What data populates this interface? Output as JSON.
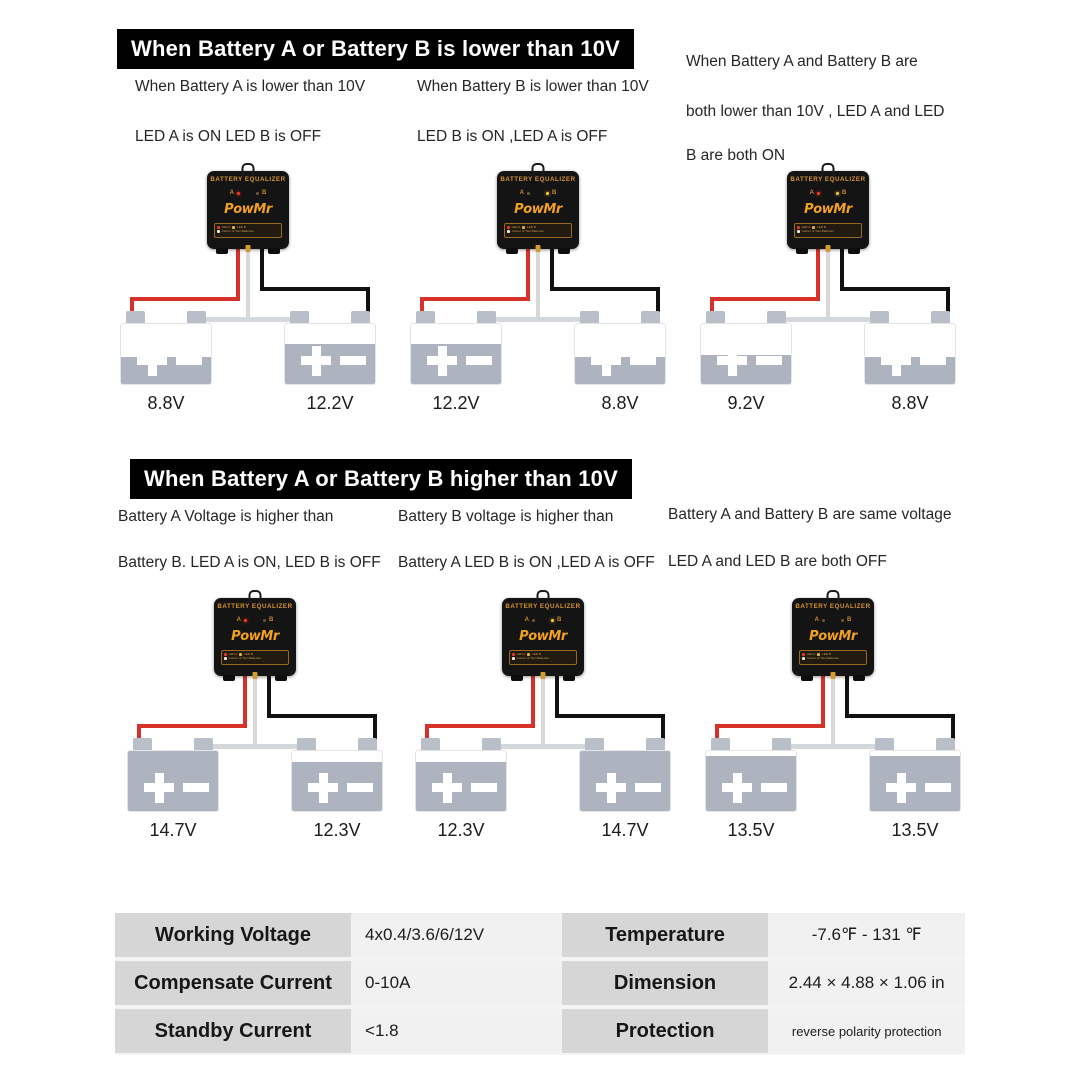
{
  "sections": [
    {
      "header": "When Battery A or Battery B is lower than 10V",
      "columns": [
        {
          "caption_lines": [
            "When Battery A is lower than 10V",
            "LED A is ON  LED B is OFF"
          ],
          "led_a": "on",
          "led_b": "off",
          "battery_left": {
            "voltage": "8.8V",
            "fill_percent": 45
          },
          "battery_right": {
            "voltage": "12.2V",
            "fill_percent": 66
          }
        },
        {
          "caption_lines": [
            "When Battery B is lower than 10V",
            "LED B is ON ,LED A is OFF"
          ],
          "led_a": "off",
          "led_b": "on",
          "battery_left": {
            "voltage": "12.2V",
            "fill_percent": 66
          },
          "battery_right": {
            "voltage": "8.8V",
            "fill_percent": 45
          }
        },
        {
          "caption_lines": [
            "When Battery A and Battery B are",
            "both lower than 10V ,  LED A and LED",
            "B are both ON"
          ],
          "led_a": "on",
          "led_b": "on",
          "battery_left": {
            "voltage": "9.2V",
            "fill_percent": 48
          },
          "battery_right": {
            "voltage": "8.8V",
            "fill_percent": 45
          }
        }
      ]
    },
    {
      "header": "When Battery A or Battery B higher than 10V",
      "columns": [
        {
          "caption_lines": [
            "Battery A Voltage is higher than",
            "Battery B. LED A is ON, LED B is OFF"
          ],
          "led_a": "on",
          "led_b": "off",
          "battery_left": {
            "voltage": "14.7V",
            "fill_percent": 100
          },
          "battery_right": {
            "voltage": "12.3V",
            "fill_percent": 82
          }
        },
        {
          "caption_lines": [
            "Battery B voltage is higher than",
            "Battery A LED B is ON ,LED A is OFF"
          ],
          "led_a": "off",
          "led_b": "on",
          "battery_left": {
            "voltage": "12.3V",
            "fill_percent": 82
          },
          "battery_right": {
            "voltage": "14.7V",
            "fill_percent": 100
          }
        },
        {
          "caption_lines": [
            "Battery A and Battery B are same voltage",
            "LED A and LED B are both OFF"
          ],
          "led_a": "off",
          "led_b": "off",
          "battery_left": {
            "voltage": "13.5V",
            "fill_percent": 92
          },
          "battery_right": {
            "voltage": "13.5V",
            "fill_percent": 92
          }
        }
      ]
    }
  ],
  "device": {
    "title": "BATTERY EQUALIZER",
    "brand": "PowMr",
    "led_a_label": "A",
    "led_b_label": "B",
    "sticker_row1_left": "LED A",
    "sticker_row1_right": "LED B",
    "sticker_row2": "Center of Two Batteries"
  },
  "spec_table": {
    "rows": [
      {
        "label_left": "Working Voltage",
        "value_left": "4x0.4/3.6/6/12V",
        "label_right": "Temperature",
        "value_right": "-7.6℉ - 131 ℉"
      },
      {
        "label_left": "Compensate Current",
        "value_left": "0-10A",
        "label_right": "Dimension",
        "value_right": "2.44 × 4.88 × 1.06 in"
      },
      {
        "label_left": "Standby Current",
        "value_left": "<1.8",
        "label_right": "Protection",
        "value_right": "reverse polarity protection"
      }
    ]
  },
  "colors": {
    "wire_positive": "#d6322a",
    "wire_negative": "#111111",
    "wire_center": "#d8d8d8",
    "battery_fill": "#adb4c0",
    "brand_orange": "#f2a021",
    "header_bar": "#000000"
  }
}
